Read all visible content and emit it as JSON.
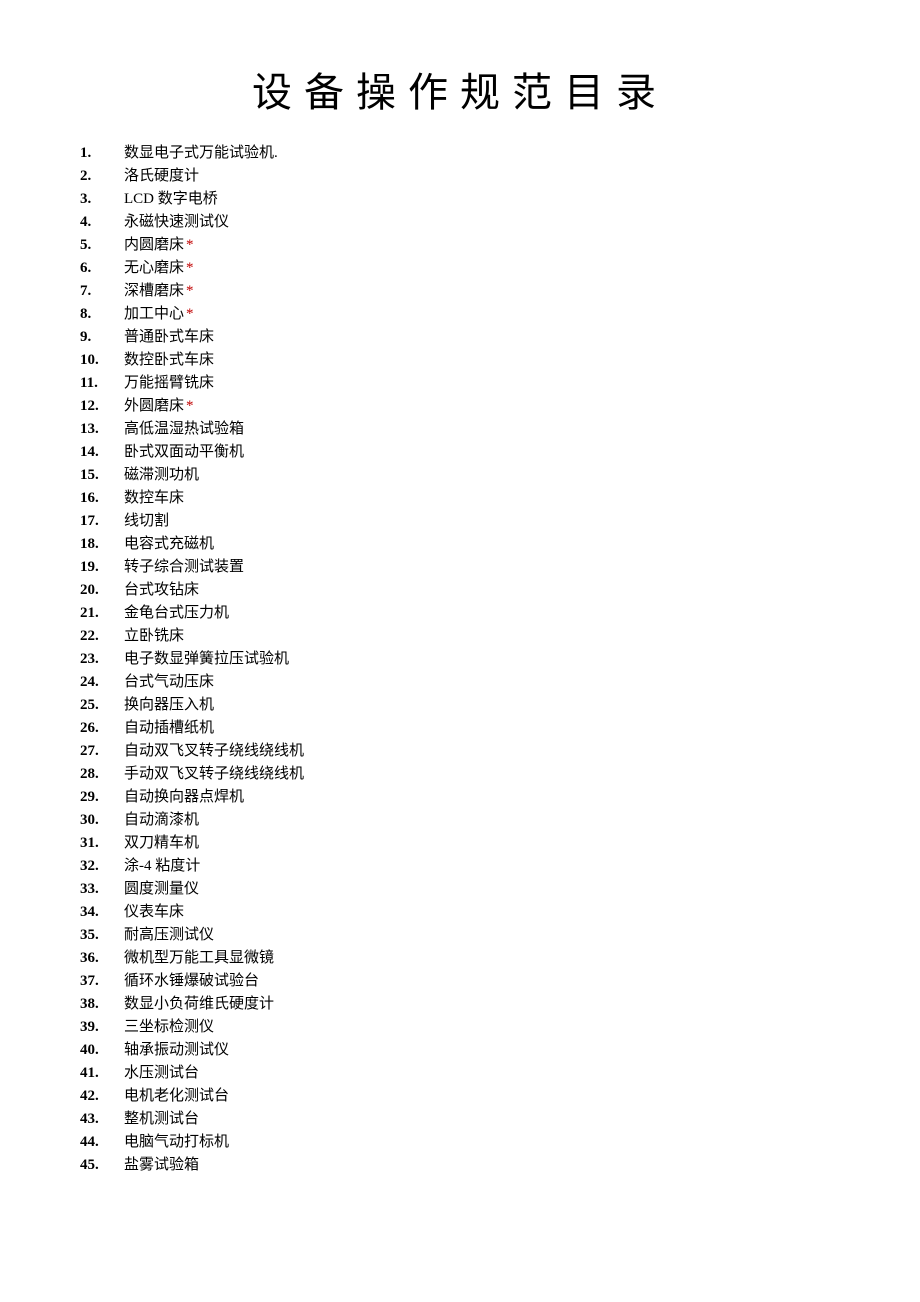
{
  "title": "设备操作规范目录",
  "items": [
    {
      "num": "1.",
      "text": "数显电子式万能试验机.",
      "star": false
    },
    {
      "num": "2.",
      "text": "洛氏硬度计",
      "star": false
    },
    {
      "num": "3.",
      "text": "LCD 数字电桥",
      "star": false
    },
    {
      "num": "4.",
      "text": "永磁快速测试仪",
      "star": false
    },
    {
      "num": "5.",
      "text": "内圆磨床 ",
      "star": true
    },
    {
      "num": "6.",
      "text": "无心磨床 ",
      "star": true
    },
    {
      "num": "7.",
      "text": "深槽磨床",
      "star": true
    },
    {
      "num": "8.",
      "text": "加工中心",
      "star": true
    },
    {
      "num": "9.",
      "text": "普通卧式车床",
      "star": false
    },
    {
      "num": "10.",
      "text": "数控卧式车床",
      "star": false
    },
    {
      "num": "11.",
      "text": "万能摇臂铣床",
      "star": false
    },
    {
      "num": "12.",
      "text": "外圆磨床 ",
      "star": true
    },
    {
      "num": "13.",
      "text": "高低温湿热试验箱",
      "star": false
    },
    {
      "num": "14.",
      "text": "卧式双面动平衡机",
      "star": false
    },
    {
      "num": "15.",
      "text": "磁滞测功机",
      "star": false
    },
    {
      "num": "16.",
      "text": "数控车床",
      "star": false
    },
    {
      "num": "17.",
      "text": "线切割",
      "star": false
    },
    {
      "num": "18.",
      "text": "电容式充磁机",
      "star": false
    },
    {
      "num": "19.",
      "text": "转子综合测试装置",
      "star": false
    },
    {
      "num": "20.",
      "text": "台式攻钻床",
      "star": false
    },
    {
      "num": "21.",
      "text": "金龟台式压力机",
      "star": false
    },
    {
      "num": "22.",
      "text": "立卧铣床",
      "star": false
    },
    {
      "num": "23.",
      "text": "电子数显弹簧拉压试验机",
      "star": false
    },
    {
      "num": "24.",
      "text": "台式气动压床",
      "star": false
    },
    {
      "num": "25.",
      "text": "换向器压入机",
      "star": false
    },
    {
      "num": "26.",
      "text": "自动插槽纸机",
      "star": false
    },
    {
      "num": "27.",
      "text": "自动双飞叉转子绕线绕线机",
      "star": false
    },
    {
      "num": "28.",
      "text": "手动双飞叉转子绕线绕线机",
      "star": false
    },
    {
      "num": "29.",
      "text": "自动换向器点焊机",
      "star": false
    },
    {
      "num": "30.",
      "text": "自动滴漆机",
      "star": false
    },
    {
      "num": "31.",
      "text": "双刀精车机",
      "star": false
    },
    {
      "num": "32.",
      "text": "涂-4 粘度计",
      "star": false
    },
    {
      "num": "33.",
      "text": "圆度测量仪",
      "star": false
    },
    {
      "num": "34.",
      "text": "仪表车床",
      "star": false
    },
    {
      "num": "35.",
      "text": "耐高压测试仪",
      "star": false
    },
    {
      "num": "36.",
      "text": "微机型万能工具显微镜",
      "star": false
    },
    {
      "num": "37.",
      "text": "循环水锤爆破试验台",
      "star": false
    },
    {
      "num": "38.",
      "text": "数显小负荷维氏硬度计",
      "star": false
    },
    {
      "num": "39.",
      "text": "三坐标检测仪",
      "star": false
    },
    {
      "num": "40.",
      "text": "轴承振动测试仪",
      "star": false
    },
    {
      "num": "41.",
      "text": "水压测试台",
      "star": false
    },
    {
      "num": "42.",
      "text": "电机老化测试台",
      "star": false
    },
    {
      "num": "43.",
      "text": "整机测试台",
      "star": false
    },
    {
      "num": "44.",
      "text": "电脑气动打标机",
      "star": false
    },
    {
      "num": "45.",
      "text": "盐雾试验箱",
      "star": false
    }
  ]
}
